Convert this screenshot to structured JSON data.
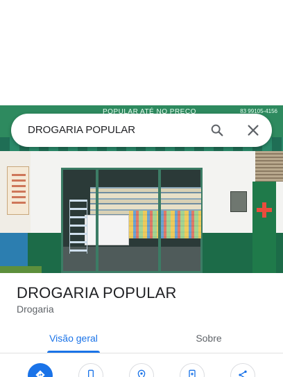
{
  "search": {
    "query": "DROGARIA POPULAR"
  },
  "photo": {
    "sign_text": "POPULAR ATÉ NO PREÇO",
    "sign_phone": "83 99105-4156"
  },
  "place": {
    "title": "DROGARIA POPULAR",
    "category": "Drogaria"
  },
  "tabs": [
    {
      "label": "Visão geral",
      "selected": true
    },
    {
      "label": "Sobre",
      "selected": false
    }
  ],
  "actions": [
    {
      "icon": "directions-icon"
    },
    {
      "icon": "phone-icon"
    },
    {
      "icon": "location-icon"
    },
    {
      "icon": "save-icon"
    },
    {
      "icon": "share-icon"
    }
  ],
  "colors": {
    "accent": "#1a73e8",
    "text_primary": "#202124",
    "text_secondary": "#5f6368"
  }
}
